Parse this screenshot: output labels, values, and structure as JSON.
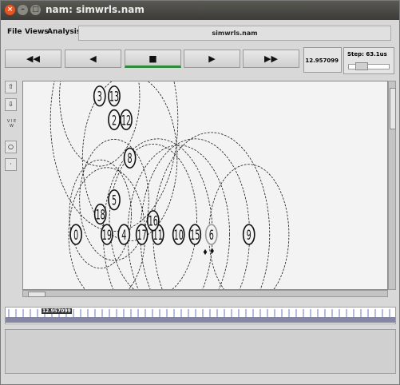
{
  "window": {
    "title": "nam: simwrls.nam",
    "controls": {
      "close": "×",
      "minimize": "–",
      "maximize": "□"
    }
  },
  "menu": {
    "file": "File",
    "views": "Views",
    "analysis": "Analysis",
    "filename": "simwrls.nam"
  },
  "transport": {
    "rewind": "◀◀",
    "back": "◀",
    "stop": "■",
    "play": "▶",
    "fast_forward": "▶▶",
    "time": "12.957099",
    "step_label": "Step: 63.1us"
  },
  "tools": {
    "view_label": "V I E W"
  },
  "nodes": [
    {
      "id": "0",
      "x": 14.5,
      "y": 42.0
    },
    {
      "id": "19",
      "x": 23.0,
      "y": 42.0
    },
    {
      "id": "4",
      "x": 27.7,
      "y": 42.0
    },
    {
      "id": "17",
      "x": 32.6,
      "y": 42.0
    },
    {
      "id": "11",
      "x": 37.0,
      "y": 42.0
    },
    {
      "id": "10",
      "x": 42.7,
      "y": 42.0
    },
    {
      "id": "15",
      "x": 47.2,
      "y": 42.0
    },
    {
      "id": "6",
      "x": 51.7,
      "y": 42.0
    },
    {
      "id": "9",
      "x": 62.0,
      "y": 42.0
    },
    {
      "id": "16",
      "x": 35.7,
      "y": 38.2
    },
    {
      "id": "18",
      "x": 21.2,
      "y": 36.4
    },
    {
      "id": "5",
      "x": 25.0,
      "y": 32.5
    },
    {
      "id": "8",
      "x": 29.3,
      "y": 21.0
    },
    {
      "id": "2",
      "x": 25.0,
      "y": 10.5
    },
    {
      "id": "12",
      "x": 28.3,
      "y": 10.5
    },
    {
      "id": "3",
      "x": 21.0,
      "y": 4.0
    },
    {
      "id": "13",
      "x": 25.0,
      "y": 4.0
    }
  ],
  "ranges": [
    {
      "x": 21.0,
      "y": 4.0,
      "r": 11.0
    },
    {
      "x": 25.0,
      "y": 10.5,
      "r": 17.5
    },
    {
      "x": 29.3,
      "y": 21.0,
      "r": 13.0
    },
    {
      "x": 25.0,
      "y": 32.5,
      "r": 9.5
    },
    {
      "x": 23.0,
      "y": 42.0,
      "r": 10.5
    },
    {
      "x": 21.2,
      "y": 36.4,
      "r": 8.5
    },
    {
      "x": 37.0,
      "y": 42.0,
      "r": 15.0
    },
    {
      "x": 42.7,
      "y": 42.0,
      "r": 14.0
    },
    {
      "x": 47.2,
      "y": 42.0,
      "r": 15.0
    },
    {
      "x": 51.7,
      "y": 42.0,
      "r": 16.0
    },
    {
      "x": 62.0,
      "y": 42.0,
      "r": 11.0
    },
    {
      "x": 35.7,
      "y": 38.2,
      "r": 12.0
    }
  ],
  "packets": [
    {
      "x": 50.0,
      "y": 46.8
    },
    {
      "x": 51.9,
      "y": 46.5
    }
  ],
  "colors": {
    "active_indicator": "#2f8a3a",
    "titlebar": "#3c3b37",
    "close_button": "#e95420"
  }
}
